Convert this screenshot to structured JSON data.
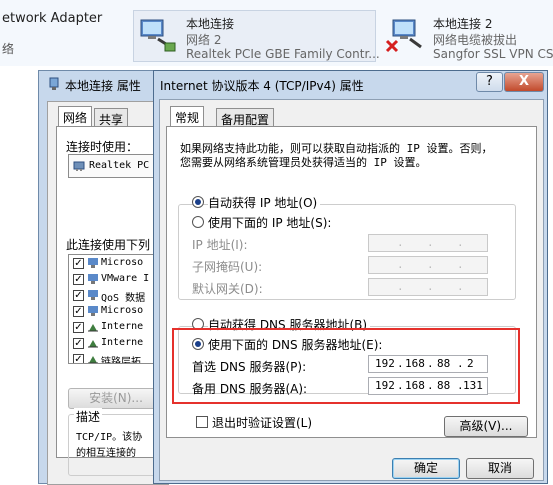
{
  "top": {
    "adapter_heading": "etwork Adapter",
    "adapter_sub": "络",
    "adapter1": {
      "name": "本地连接",
      "status": "网络  2",
      "device": "Realtek PCIe GBE Family Contr..."
    },
    "adapter2": {
      "name": "本地连接 2",
      "status": "网络电缆被拔出",
      "device": "Sangfor SSL VPN CS"
    }
  },
  "props": {
    "title": "本地连接 属性",
    "tabs": [
      "网络",
      "共享"
    ],
    "connect_using": "连接时使用：",
    "nic": "Realtek PC",
    "items_label": "此连接使用下列",
    "items": [
      {
        "label": "Microso",
        "checked": true,
        "icon": "client-icon"
      },
      {
        "label": "VMware I",
        "checked": true,
        "icon": "vmware-icon"
      },
      {
        "label": "QoS 数据",
        "checked": true,
        "icon": "qos-icon"
      },
      {
        "label": "Microso",
        "checked": true,
        "icon": "file-share-icon"
      },
      {
        "label": "Interne",
        "checked": true,
        "icon": "protocol-icon"
      },
      {
        "label": "Interne",
        "checked": true,
        "icon": "protocol-icon"
      },
      {
        "label": "链路层拓",
        "checked": true,
        "icon": "protocol-icon"
      }
    ],
    "install_btn": "安装(N)...",
    "desc_label": "描述",
    "desc_line1": "TCP/IP。该协",
    "desc_line2": "的相互连接的"
  },
  "dialog": {
    "title": "Internet 协议版本 4 (TCP/IPv4) 属性",
    "help": "?",
    "close": "X",
    "tabs": [
      "常规",
      "备用配置"
    ],
    "intro_line1": "如果网络支持此功能，则可以获取自动指派的 IP 设置。否则，",
    "intro_line2": "您需要从网络系统管理员处获得适当的 IP 设置。",
    "auto_ip": "自动获得 IP 地址(O)",
    "manual_ip": "使用下面的 IP 地址(S):",
    "ip_label": "IP 地址(I):",
    "mask_label": "子网掩码(U):",
    "gateway_label": "默认网关(D):",
    "auto_dns": "自动获得 DNS 服务器地址(B)",
    "manual_dns": "使用下面的 DNS 服务器地址(E):",
    "dns1_label": "首选 DNS 服务器(P):",
    "dns1": [
      "192",
      "168",
      "88",
      "2"
    ],
    "dns2_label": "备用 DNS 服务器(A):",
    "dns2": [
      "192",
      "168",
      "88",
      "131"
    ],
    "validate": "退出时验证设置(L)",
    "advanced": "高级(V)...",
    "ok": "确定",
    "cancel": "取消"
  },
  "colors": {
    "highlight": "#e5312c",
    "accent": "#3c7fb1"
  }
}
